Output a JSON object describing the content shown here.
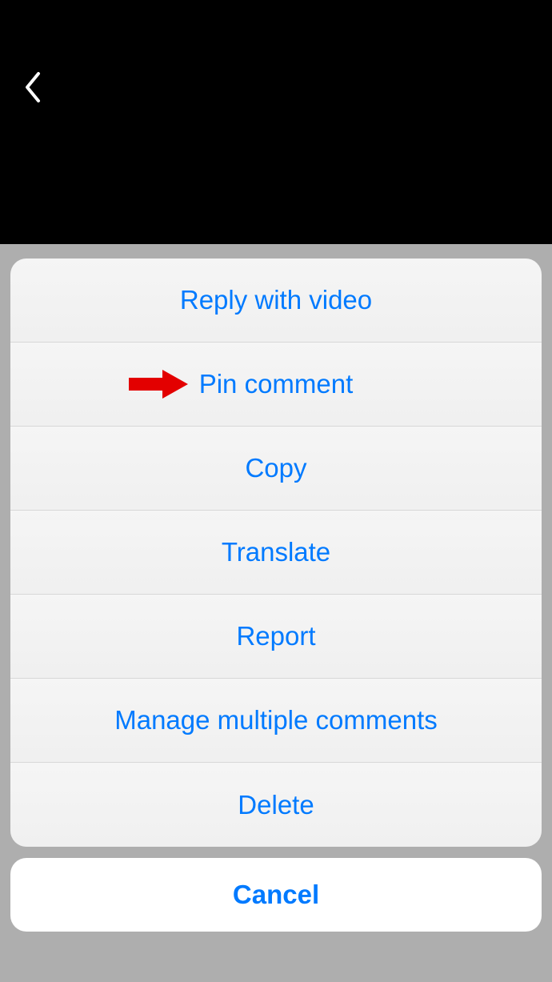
{
  "actions": {
    "reply_with_video": "Reply with video",
    "pin_comment": "Pin comment",
    "copy": "Copy",
    "translate": "Translate",
    "report": "Report",
    "manage_multiple": "Manage multiple comments",
    "delete": "Delete"
  },
  "cancel_label": "Cancel",
  "annotation": {
    "arrow_color": "#E30000"
  }
}
